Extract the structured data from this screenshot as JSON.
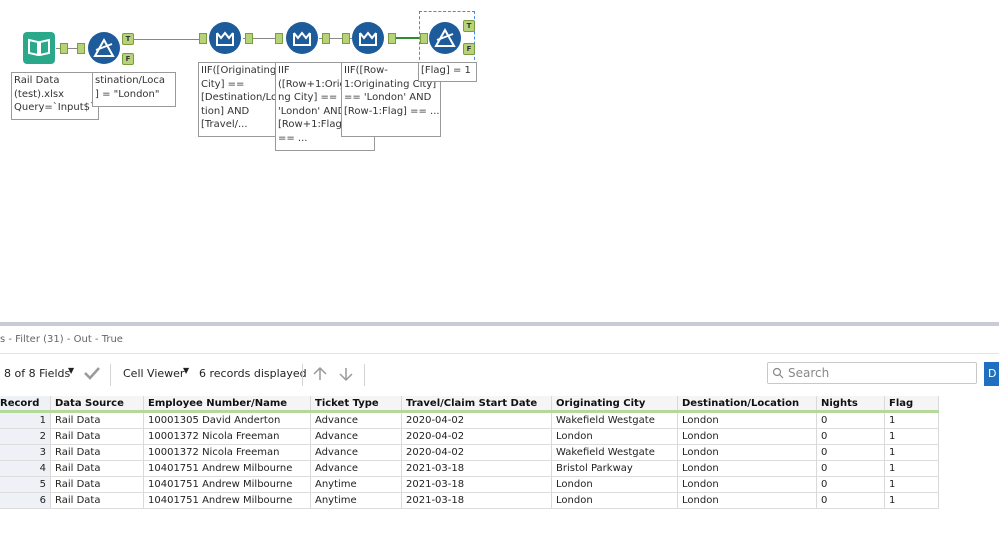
{
  "workflow": {
    "annotations": {
      "input": "Rail Data\n(test).xlsx\nQuery=`Input$`",
      "filter1": "stination/Loca\n] = \"London\"",
      "formula1": "IIF([Originating\nCity] ==\n[Destination/Lo\ntion] AND\n[Travel/...",
      "formula2": "IIF\n([Row+1:Orig\nng City] ==\n'London' AND\n[Row+1:Flag]\n== ...",
      "formula3": "IIF([Row-\n1:Originating City]\n== 'London' AND\n[Row-1:Flag] == ...",
      "filter2": "[Flag] = 1"
    },
    "anchor_labels": {
      "true": "T",
      "false": "F"
    },
    "icons": [
      "book-icon",
      "filter-icon",
      "formula-icon"
    ]
  },
  "results": {
    "title": "s - Filter (31) - Out - True",
    "fields_label": "8 of 8 Fields",
    "cell_viewer_label": "Cell Viewer",
    "records_label": "6 records displayed",
    "search_placeholder": "Search",
    "d_button": "D",
    "columns": [
      "Record",
      "Data Source",
      "Employee Number/Name",
      "Ticket Type",
      "Travel/Claim Start Date",
      "Originating City",
      "Destination/Location",
      "Nights",
      "Flag"
    ],
    "rows": [
      [
        "1",
        "Rail Data",
        "10001305 David Anderton",
        "Advance",
        "2020-04-02",
        "Wakefield Westgate",
        "London",
        "0",
        "1"
      ],
      [
        "2",
        "Rail Data",
        "10001372 Nicola Freeman",
        "Advance",
        "2020-04-02",
        "London",
        "London",
        "0",
        "1"
      ],
      [
        "3",
        "Rail Data",
        "10001372 Nicola Freeman",
        "Advance",
        "2020-04-02",
        "Wakefield Westgate",
        "London",
        "0",
        "1"
      ],
      [
        "4",
        "Rail Data",
        "10401751 Andrew Milbourne",
        "Advance",
        "2021-03-18",
        "Bristol Parkway",
        "London",
        "0",
        "1"
      ],
      [
        "5",
        "Rail Data",
        "10401751 Andrew Milbourne",
        "Anytime",
        "2021-03-18",
        "London",
        "London",
        "0",
        "1"
      ],
      [
        "6",
        "Rail Data",
        "10401751 Andrew Milbourne",
        "Anytime",
        "2021-03-18",
        "London",
        "London",
        "0",
        "1"
      ]
    ]
  }
}
